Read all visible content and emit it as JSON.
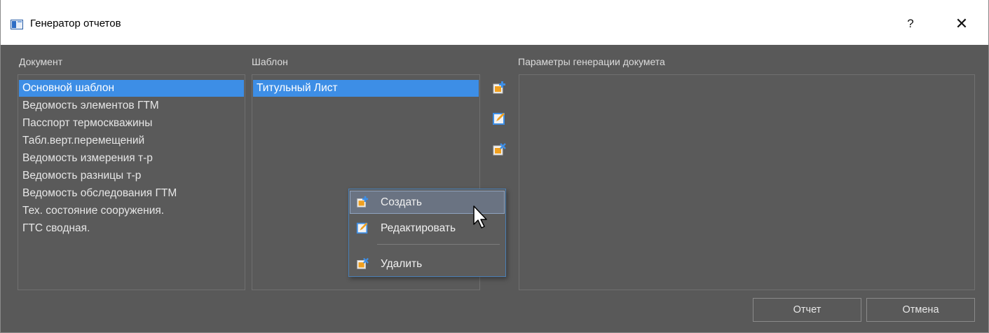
{
  "window": {
    "title": "Генератор отчетов",
    "help_label": "?",
    "close_label": "✕"
  },
  "document_panel": {
    "label": "Документ",
    "items": [
      {
        "label": "Основной шаблон",
        "selected": true
      },
      {
        "label": "Ведомость элементов ГТМ"
      },
      {
        "label": "Пасспорт термоскважины"
      },
      {
        "label": "Табл.верт.перемещений"
      },
      {
        "label": "Ведомость измерения т-р"
      },
      {
        "label": "Ведомость разницы т-р"
      },
      {
        "label": "Ведомость обследования ГТМ"
      },
      {
        "label": "Тех. состояние сооружения."
      },
      {
        "label": "ГТС сводная."
      }
    ]
  },
  "template_panel": {
    "label": "Шаблон",
    "items": [
      {
        "label": "Титульный Лист",
        "selected": true
      }
    ],
    "tools": [
      "add-template-icon",
      "edit-template-icon",
      "delete-template-icon"
    ]
  },
  "params_panel": {
    "label": "Параметры генерации докумета"
  },
  "context_menu": {
    "items": [
      {
        "label": "Создать",
        "icon": "add-icon",
        "hover": true
      },
      {
        "label": "Редактировать",
        "icon": "edit-icon"
      },
      {
        "label": "Удалить",
        "icon": "delete-icon"
      }
    ]
  },
  "buttons": {
    "report_label": "Отчет",
    "cancel_label": "Отмена"
  },
  "colors": {
    "background": "#595959",
    "selection": "#3d8ee6",
    "icon_orange": "#f0a020",
    "icon_blue": "#3d8ee6"
  }
}
